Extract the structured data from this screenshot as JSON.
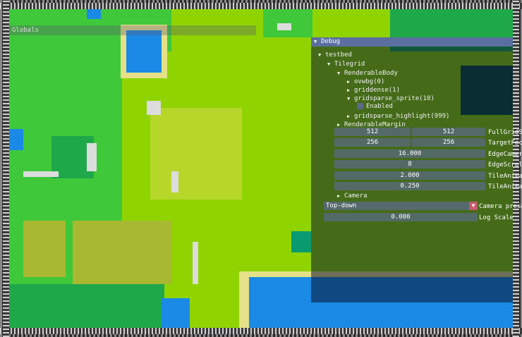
{
  "globals": {
    "title": "Globals"
  },
  "debug": {
    "title": "Debug",
    "tree": {
      "testbed": "testbed",
      "tilegrid": "Tilegrid",
      "renderable_body": "RenderableBody",
      "ovwbg": "ovwbg(0)",
      "griddense": "griddense(1)",
      "gridsparse_sprite": "gridsparse_sprite(10)",
      "enabled": "Enabled",
      "gridsparse_highlight": "gridsparse_highlight(999)",
      "renderable_margin": "RenderableMargin",
      "camera": "Camera"
    },
    "fields": [
      {
        "label": "FullGridSi",
        "values": [
          "512",
          "512"
        ]
      },
      {
        "label": "TargetFoca",
        "values": [
          "256",
          "256"
        ]
      },
      {
        "label": "EdgeCamera",
        "values": [
          "16.000"
        ]
      },
      {
        "label": "EdgeScroll",
        "values": [
          "8"
        ]
      },
      {
        "label": "TileAnimat",
        "values": [
          "2.000"
        ]
      },
      {
        "label": "TileAnimat",
        "values": [
          "0.250"
        ]
      }
    ],
    "camera_preset": {
      "value": "Top-down",
      "label": "Camera preset"
    },
    "log_scale": {
      "value": "0.000",
      "label": "Log Scale"
    }
  },
  "colors": {
    "grass": "#8fd400",
    "dark_grass": "#3fc83a",
    "forest": "#1fa84a",
    "water": "#1a8ae6",
    "sand": "#e6e08a",
    "rock": "#dcdcdc",
    "olive": "#a8b830",
    "panel_title": "#5a6fa0"
  }
}
